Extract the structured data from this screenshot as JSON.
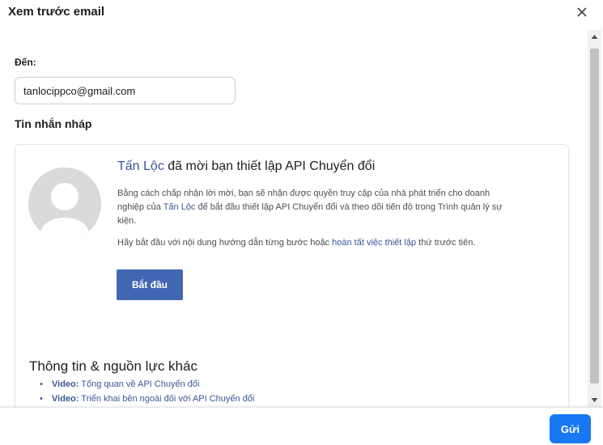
{
  "dialog": {
    "title": "Xem trước email",
    "close_icon": "close-icon"
  },
  "form": {
    "to_label": "Đến:",
    "to_value": "tanlocippco@gmail.com",
    "draft_label": "Tin nhắn nháp"
  },
  "email": {
    "avatar_icon": "person-placeholder-icon",
    "inviter_name": "Tấn Lộc",
    "headline_rest": " đã mời bạn thiết lập API Chuyển đổi",
    "para1_part1": "Bằng cách chấp nhận lời mời, bạn sẽ nhận được quyền truy cập của nhà phát triển cho doanh nghiệp của ",
    "para1_link": "Tấn Lộc",
    "para1_part2": " để bắt đầu thiết lập API Chuyển đổi và theo dõi tiến độ trong Trình quản lý sự kiện.",
    "para2_part1": "Hãy bắt đầu với nội dung hướng dẫn từng bước hoặc ",
    "para2_link": "hoàn tất việc thiết lập",
    "para2_part2": " thứ trước tiên.",
    "start_button": "Bắt đầu",
    "more_title": "Thông tin & nguồn lực khác",
    "more_items": [
      {
        "prefix": "Video:",
        "text": " Tổng quan về API Chuyển đổi"
      },
      {
        "prefix": "Video:",
        "text": " Triển khai bên ngoài đối với API Chuyển đổi"
      }
    ]
  },
  "footer": {
    "send_button": "Gửi"
  },
  "colors": {
    "accent": "#1877f2",
    "button_dark": "#4267b2",
    "link": "#385898"
  }
}
